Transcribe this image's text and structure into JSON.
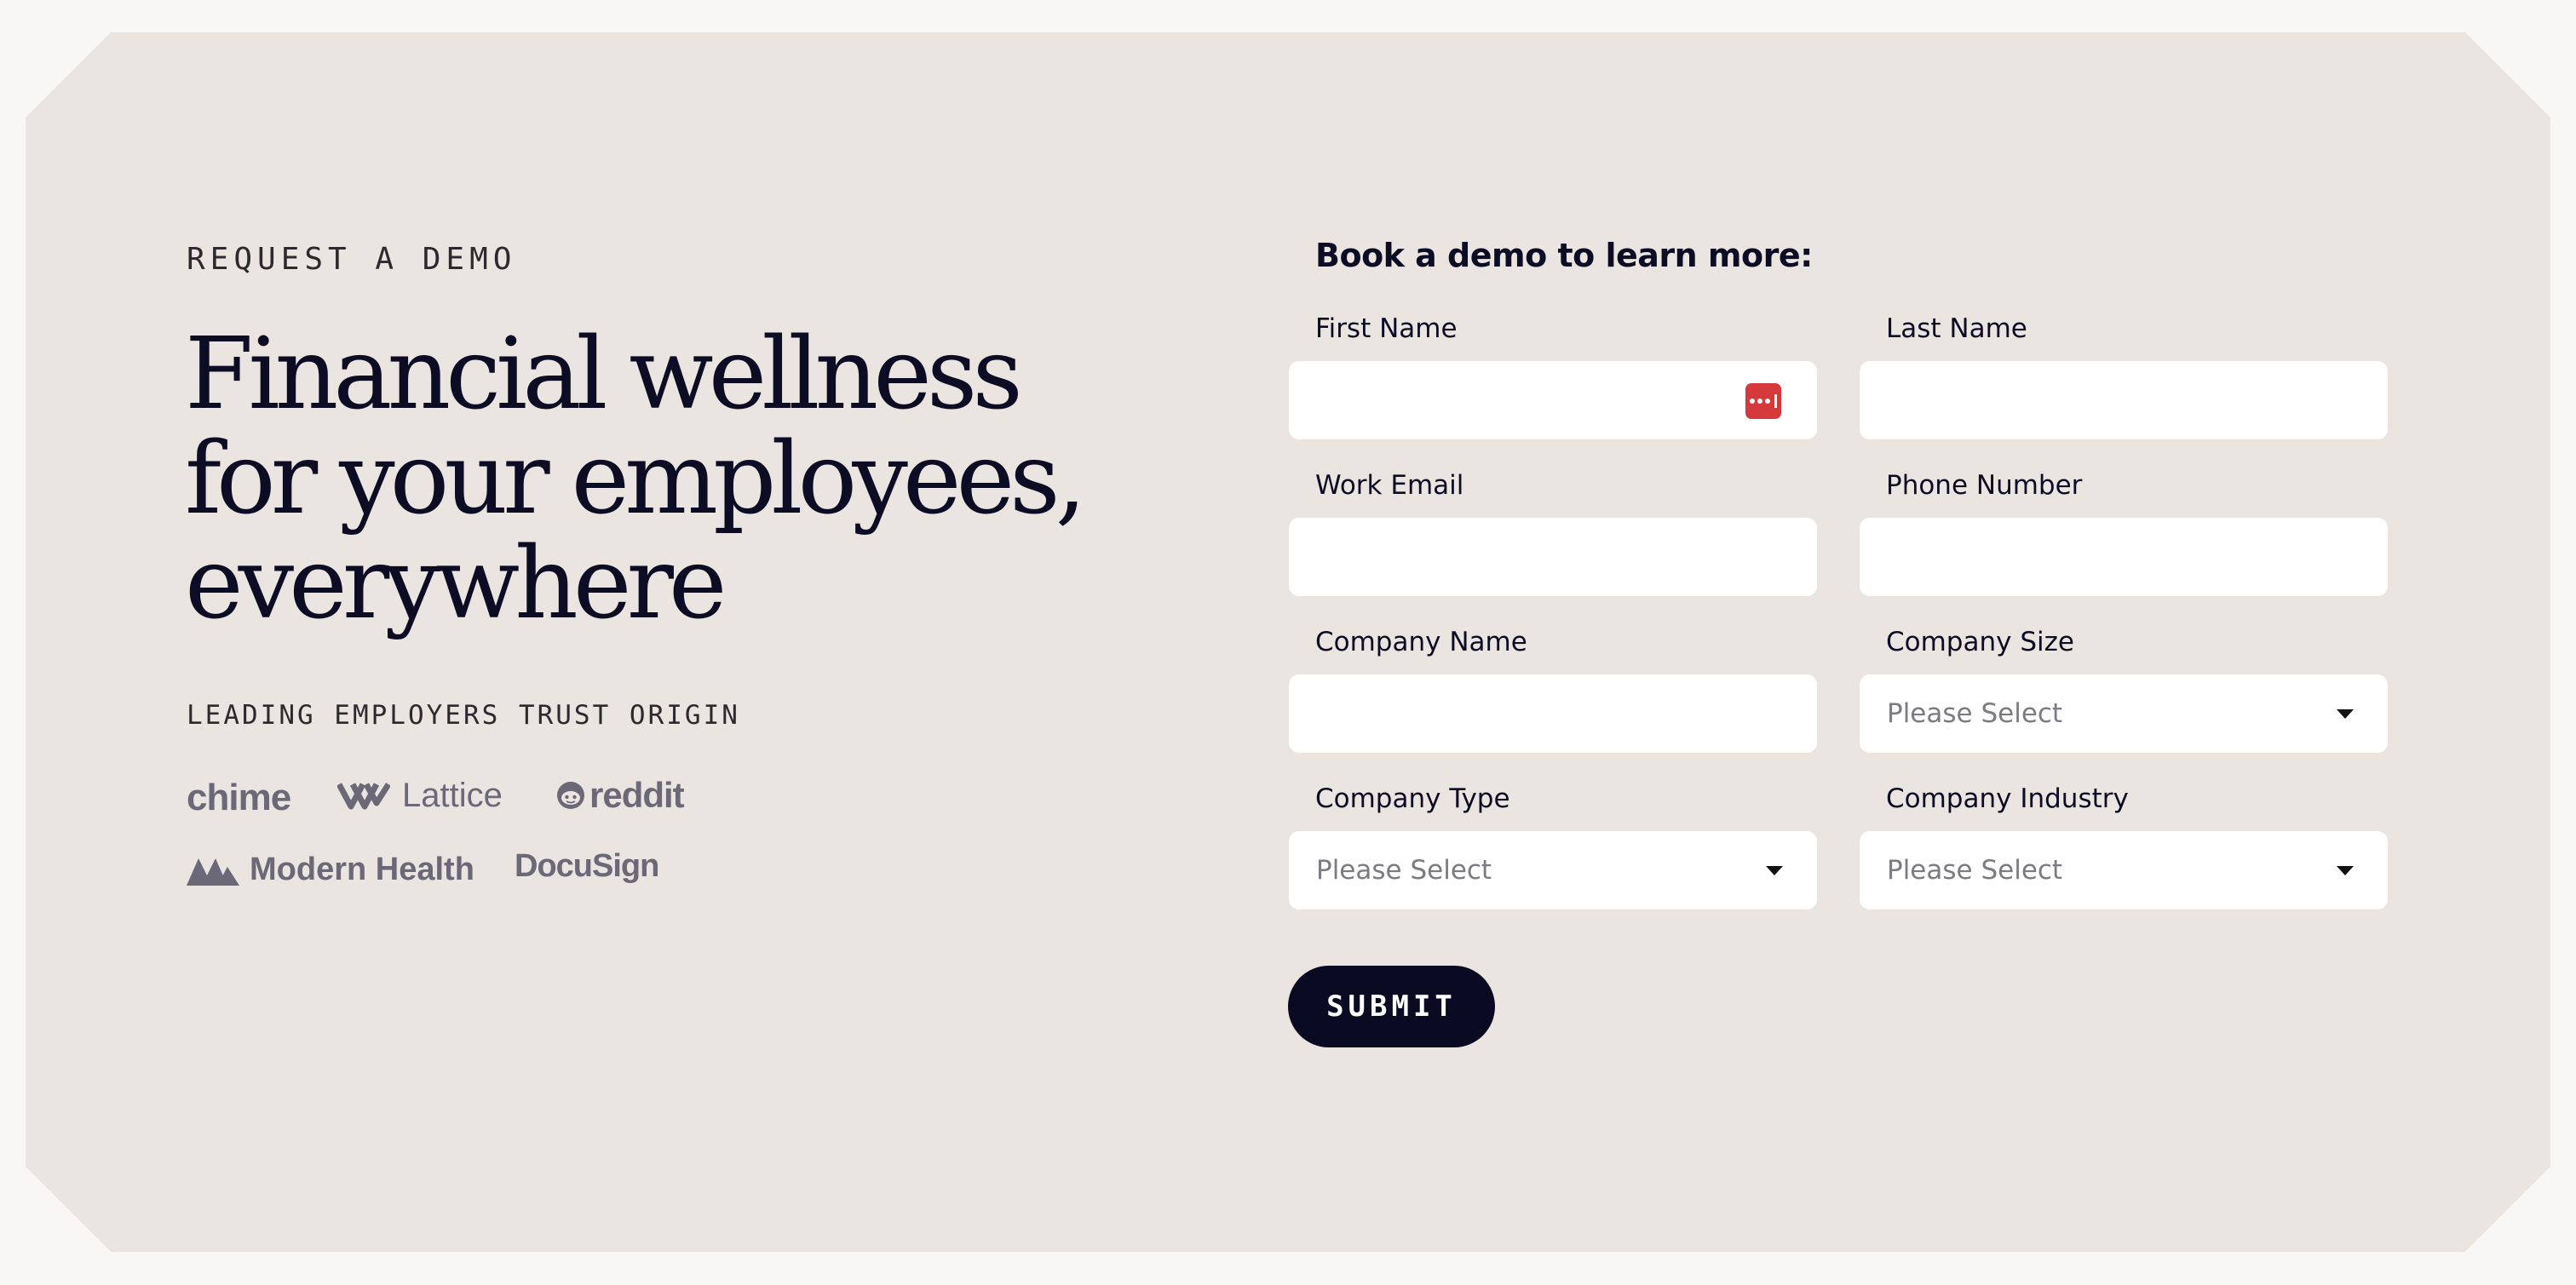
{
  "hero": {
    "eyebrow": "REQUEST A DEMO",
    "headline": "Financial wellness for your employees, everywhere",
    "trust_label": "LEADING EMPLOYERS TRUST ORIGIN",
    "logos": [
      {
        "name": "chime-logo",
        "text": "chime"
      },
      {
        "name": "lattice-logo",
        "text": "Lattice"
      },
      {
        "name": "reddit-logo",
        "text": "reddit"
      },
      {
        "name": "modern-health-logo",
        "text": "Modern Health"
      },
      {
        "name": "docusign-logo",
        "text": "DocuSign"
      }
    ]
  },
  "form": {
    "title": "Book a demo to learn more:",
    "fields": {
      "first_name": {
        "label": "First Name",
        "value": ""
      },
      "last_name": {
        "label": "Last Name",
        "value": ""
      },
      "work_email": {
        "label": "Work Email",
        "value": ""
      },
      "phone_number": {
        "label": "Phone Number",
        "value": ""
      },
      "company_name": {
        "label": "Company Name",
        "value": ""
      },
      "company_size": {
        "label": "Company Size",
        "selected": "Please Select"
      },
      "company_type": {
        "label": "Company Type",
        "selected": "Please Select"
      },
      "company_industry": {
        "label": "Company Industry",
        "selected": "Please Select"
      }
    },
    "submit_label": "SUBMIT"
  },
  "colors": {
    "page_bg": "#f8f7f5",
    "card_bg": "#ebe5e1",
    "ink": "#0c0d25",
    "logo_gray": "#6b6877",
    "button_bg": "#0a0a22",
    "password_icon": "#d6393b"
  }
}
